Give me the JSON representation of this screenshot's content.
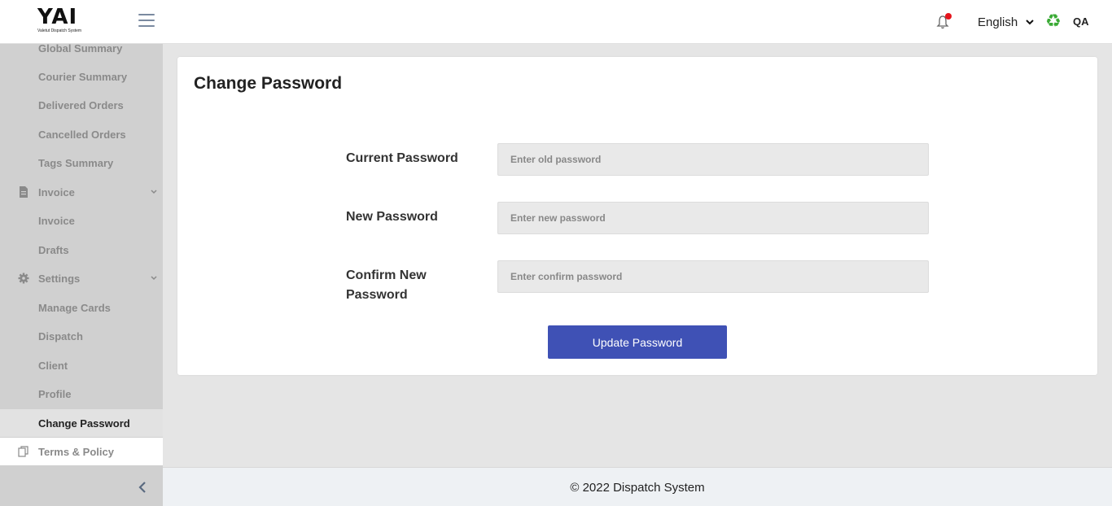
{
  "header": {
    "logo_mark": "YAI",
    "logo_sub": "Valetut Dispatch System",
    "language": "English",
    "user": "QA"
  },
  "sidebar": {
    "items": [
      {
        "label": "Global Summary"
      },
      {
        "label": "Courier Summary"
      },
      {
        "label": "Delivered Orders"
      },
      {
        "label": "Cancelled Orders"
      },
      {
        "label": "Tags Summary"
      },
      {
        "label": "Invoice",
        "icon": "document-icon"
      },
      {
        "label": "Invoice"
      },
      {
        "label": "Drafts"
      },
      {
        "label": "Settings",
        "icon": "gear-icon"
      },
      {
        "label": "Manage Cards"
      },
      {
        "label": "Dispatch"
      },
      {
        "label": "Client"
      },
      {
        "label": "Profile"
      },
      {
        "label": "Change Password"
      },
      {
        "label": "Terms & Policy",
        "icon": "copy-icon"
      }
    ]
  },
  "main": {
    "title": "Change Password",
    "fields": {
      "current": {
        "label": "Current Password",
        "placeholder": "Enter old password",
        "value": ""
      },
      "new": {
        "label": "New Password",
        "placeholder": "Enter new password",
        "value": ""
      },
      "confirm": {
        "label": "Confirm New Password",
        "placeholder": "Enter confirm password",
        "value": ""
      }
    },
    "submit_label": "Update Password"
  },
  "footer": {
    "text": "© 2022 Dispatch System"
  },
  "colors": {
    "primary": "#3f51b5",
    "notification_dot": "#e5141c",
    "recycle": "#3aaa35"
  }
}
